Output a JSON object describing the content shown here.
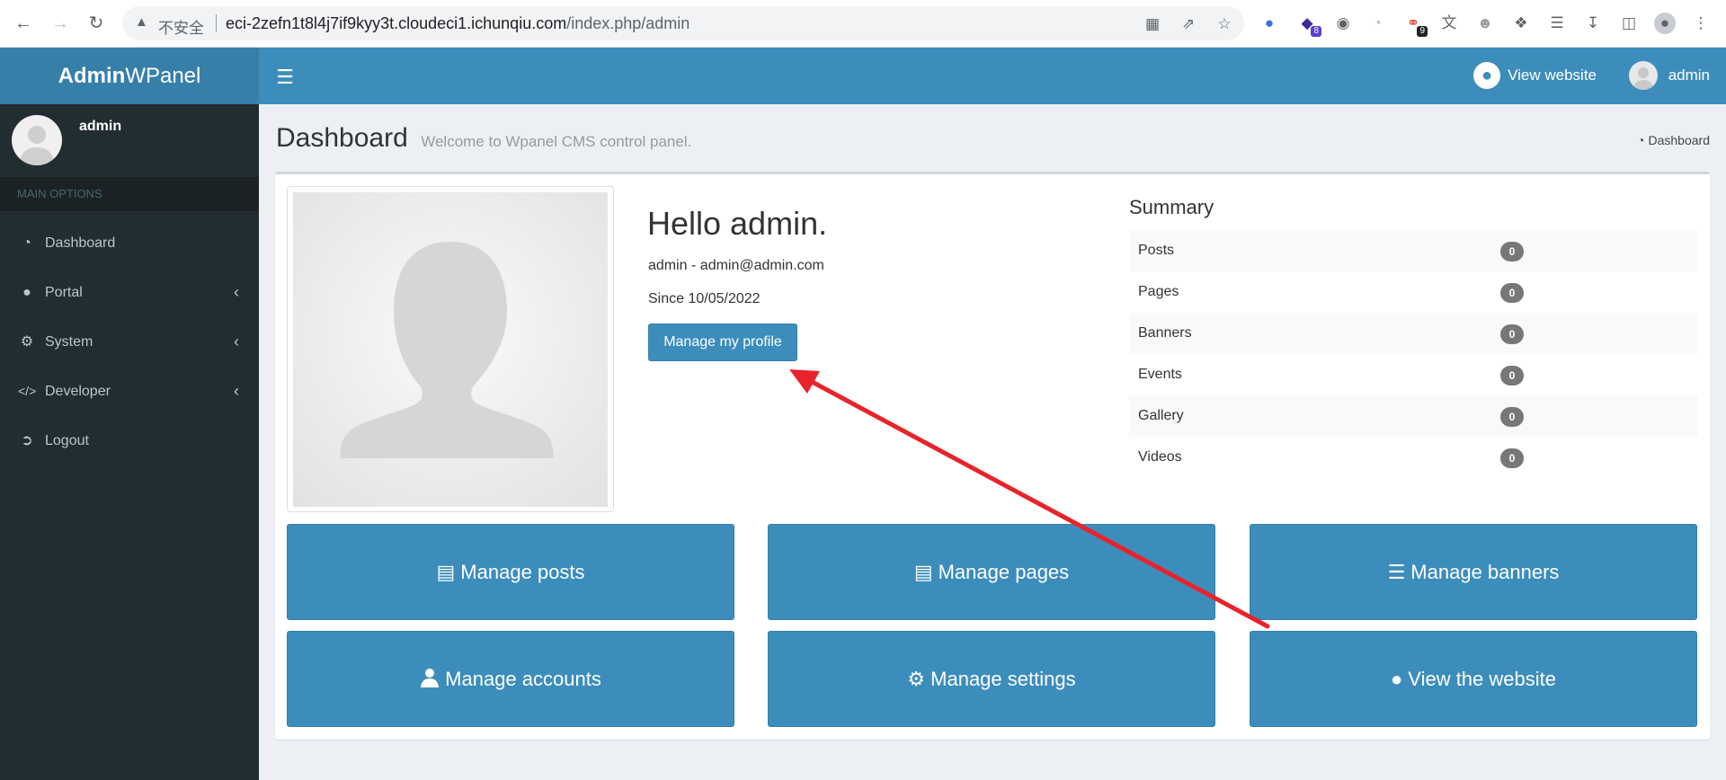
{
  "browser": {
    "insecure_label": "不安全",
    "url_host": "eci-2zefn1t8l4j7if9kyy3t.cloudeci1.ichunqiu.com",
    "url_path": "/index.php/admin",
    "ext_badges": [
      "8",
      "9"
    ]
  },
  "header": {
    "logo_bold": "Admin",
    "logo_rest": "WPanel",
    "view_website": "View website",
    "username": "admin"
  },
  "sidebar": {
    "username": "admin",
    "section_header": "MAIN OPTIONS",
    "items": [
      {
        "label": "Dashboard",
        "icon": "dashboard-icon"
      },
      {
        "label": "Portal",
        "icon": "globe-icon"
      },
      {
        "label": "System",
        "icon": "gears-icon"
      },
      {
        "label": "Developer",
        "icon": "code-icon"
      },
      {
        "label": "Logout",
        "icon": "sign-out-icon"
      }
    ]
  },
  "content": {
    "title": "Dashboard",
    "subtitle": "Welcome to Wpanel CMS control panel.",
    "breadcrumb": "Dashboard"
  },
  "profile": {
    "greeting": "Hello admin.",
    "user_line": "admin - admin@admin.com",
    "since_line": "Since 10/05/2022",
    "manage_button": "Manage my profile"
  },
  "summary": {
    "title": "Summary",
    "rows": [
      {
        "label": "Posts",
        "count": "0"
      },
      {
        "label": "Pages",
        "count": "0"
      },
      {
        "label": "Banners",
        "count": "0"
      },
      {
        "label": "Events",
        "count": "0"
      },
      {
        "label": "Gallery",
        "count": "0"
      },
      {
        "label": "Videos",
        "count": "0"
      }
    ]
  },
  "tiles": [
    {
      "label": "Manage posts",
      "icon": "list-alt-icon"
    },
    {
      "label": "Manage pages",
      "icon": "list-alt-icon"
    },
    {
      "label": "Manage banners",
      "icon": "bars-icon"
    },
    {
      "label": "Manage accounts",
      "icon": "user-icon"
    },
    {
      "label": "Manage settings",
      "icon": "gear-icon"
    },
    {
      "label": "View the website",
      "icon": "globe-icon"
    }
  ],
  "colors": {
    "primary": "#3c8dbc",
    "primary_dark": "#367fa9",
    "sidebar_bg": "#222d32",
    "annotation_arrow": "#e8232a"
  }
}
